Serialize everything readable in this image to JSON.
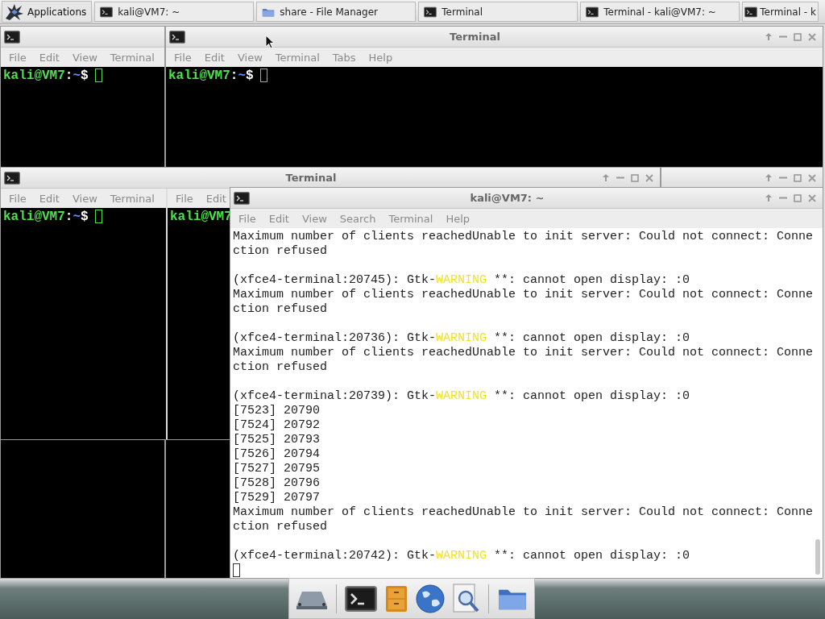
{
  "taskbar": {
    "menu_button": "Applications",
    "tasks": [
      {
        "label": "kali@VM7: ~",
        "kind": "terminal",
        "selected": false
      },
      {
        "label": "share - File Manager",
        "kind": "folder",
        "selected": false
      },
      {
        "label": "Terminal",
        "kind": "terminal",
        "selected": false
      },
      {
        "label": "Terminal - kali@VM7: ~",
        "kind": "terminal",
        "selected": false
      },
      {
        "label": "Terminal - k",
        "kind": "terminal",
        "selected": false
      }
    ]
  },
  "windows": [
    {
      "icon": true,
      "controls": false,
      "kind": "dark",
      "panes": [
        {
          "menu": [
            "File",
            "Edit",
            "View",
            "Terminal"
          ],
          "prompt": {
            "user": "kali@VM7",
            "sep": ":",
            "path": "~",
            "sign": "$",
            "cursor": true
          }
        }
      ]
    },
    {
      "title": "Terminal",
      "icon": true,
      "controls": true,
      "kind": "dark",
      "panes": [
        {
          "menu": [
            "File",
            "Edit",
            "View",
            "Terminal",
            "Tabs",
            "Help"
          ],
          "prompt": {
            "user": "kali@VM7",
            "sep": ":",
            "path": "~",
            "sign": "$",
            "cursor": true
          }
        }
      ]
    },
    {
      "title": "Terminal",
      "icon": true,
      "controls": true,
      "kind": "dark",
      "panes": [
        {
          "menu": [
            "File",
            "Edit",
            "View",
            "Terminal"
          ],
          "prompt": {
            "user": "kali@VM7",
            "sep": ":",
            "path": "~",
            "sign": "$",
            "cursor": true
          }
        },
        {
          "menu": [
            "File",
            "Edit"
          ],
          "prompt": {
            "user": "kali@VM7",
            "cursor": false
          }
        }
      ]
    },
    {
      "icon": false,
      "controls": true,
      "kind": "light"
    },
    {
      "title": "kali@VM7: ~",
      "icon": true,
      "controls": true,
      "kind": "light",
      "panes": [
        {
          "menu": [
            "File",
            "Edit",
            "View",
            "Search",
            "Terminal",
            "Help"
          ],
          "lines": [
            {
              "kind": "text",
              "text": "Maximum number of clients reachedUnable to init server: Could not connect: Conne"
            },
            {
              "kind": "text",
              "text": "ction refused"
            },
            {
              "kind": "blank"
            },
            {
              "kind": "warning",
              "prefix": "(xfce4-terminal:20745): Gtk-",
              "warning": "WARNING",
              "suffix": " **: cannot open display: :0"
            },
            {
              "kind": "text",
              "text": "Maximum number of clients reachedUnable to init server: Could not connect: Conne"
            },
            {
              "kind": "text",
              "text": "ction refused"
            },
            {
              "kind": "blank"
            },
            {
              "kind": "warning",
              "prefix": "(xfce4-terminal:20736): Gtk-",
              "warning": "WARNING",
              "suffix": " **: cannot open display: :0"
            },
            {
              "kind": "text",
              "text": "Maximum number of clients reachedUnable to init server: Could not connect: Conne"
            },
            {
              "kind": "text",
              "text": "ction refused"
            },
            {
              "kind": "blank"
            },
            {
              "kind": "warning",
              "prefix": "(xfce4-terminal:20739): Gtk-",
              "warning": "WARNING",
              "suffix": " **: cannot open display: :0"
            },
            {
              "kind": "text",
              "text": "[7523] 20790"
            },
            {
              "kind": "text",
              "text": "[7524] 20792"
            },
            {
              "kind": "text",
              "text": "[7525] 20793"
            },
            {
              "kind": "text",
              "text": "[7526] 20794"
            },
            {
              "kind": "text",
              "text": "[7527] 20795"
            },
            {
              "kind": "text",
              "text": "[7528] 20796"
            },
            {
              "kind": "text",
              "text": "[7529] 20797"
            },
            {
              "kind": "text",
              "text": "Maximum number of clients reachedUnable to init server: Could not connect: Conne"
            },
            {
              "kind": "text",
              "text": "ction refused"
            },
            {
              "kind": "blank"
            },
            {
              "kind": "warning",
              "prefix": "(xfce4-terminal:20742): Gtk-",
              "warning": "WARNING",
              "suffix": " **: cannot open display: :0"
            }
          ],
          "cursor": true
        }
      ]
    }
  ]
}
